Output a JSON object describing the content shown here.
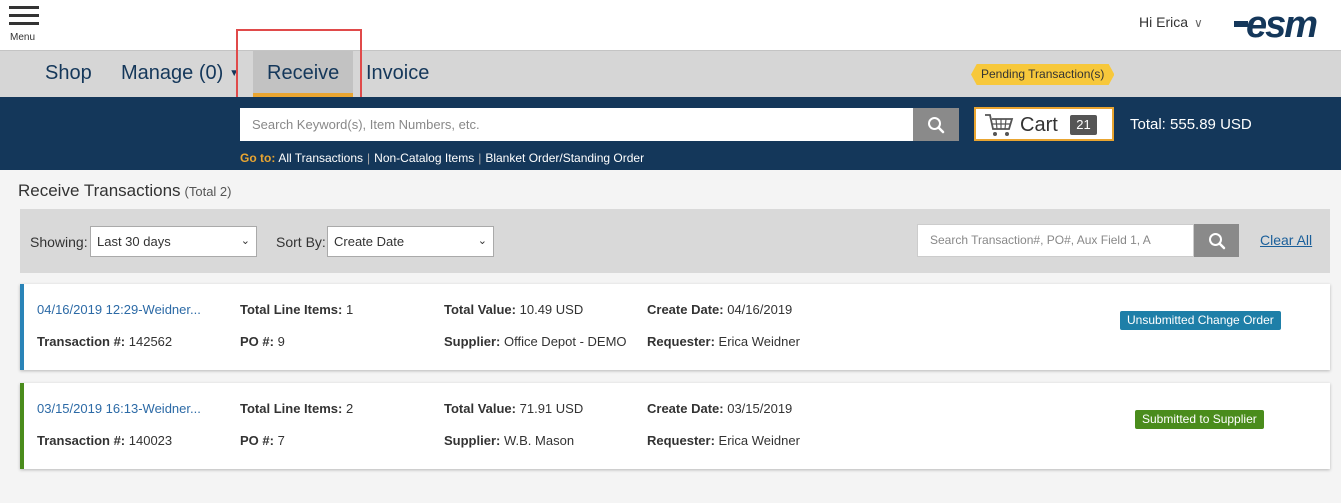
{
  "header": {
    "menu_label": "Menu",
    "greeting": "Hi Erica",
    "logo": "esm"
  },
  "nav": {
    "items": [
      {
        "label": "Shop"
      },
      {
        "label": "Manage (0)"
      },
      {
        "label": "Receive"
      },
      {
        "label": "Invoice"
      }
    ],
    "pending_badge": "Pending Transaction(s)"
  },
  "search": {
    "placeholder": "Search Keyword(s), Item Numbers, etc."
  },
  "cart": {
    "label": "Cart",
    "count": "21",
    "total": "Total: 555.89 USD"
  },
  "goto": {
    "label": "Go to:",
    "links": [
      "All Transactions",
      "Non-Catalog Items",
      "Blanket Order/Standing Order"
    ]
  },
  "page": {
    "title": "Receive Transactions",
    "subtitle": "(Total 2)"
  },
  "filters": {
    "showing_label": "Showing:",
    "showing_value": "Last 30 days",
    "sort_label": "Sort By:",
    "sort_value": "Create Date",
    "search_placeholder": "Search Transaction#, PO#, Aux Field 1, A",
    "clear_all": "Clear All"
  },
  "transactions": [
    {
      "title": "04/16/2019 12:29-Weidner...",
      "transaction_label": "Transaction #:",
      "transaction_no": "142562",
      "line_items_label": "Total Line Items:",
      "line_items": "1",
      "po_label": "PO #:",
      "po": "9",
      "value_label": "Total Value:",
      "value": "10.49 USD",
      "supplier_label": "Supplier:",
      "supplier": "Office Depot - DEMO",
      "create_label": "Create Date:",
      "create_date": "04/16/2019",
      "requester_label": "Requester:",
      "requester": "Erica Weidner",
      "status": "Unsubmitted Change Order",
      "stripe_color": "#2a84b8",
      "status_color": "#1e7fa8"
    },
    {
      "title": "03/15/2019 16:13-Weidner...",
      "transaction_label": "Transaction #:",
      "transaction_no": "140023",
      "line_items_label": "Total Line Items:",
      "line_items": "2",
      "po_label": "PO #:",
      "po": "7",
      "value_label": "Total Value:",
      "value": "71.91 USD",
      "supplier_label": "Supplier:",
      "supplier": "W.B. Mason",
      "create_label": "Create Date:",
      "create_date": "03/15/2019",
      "requester_label": "Requester:",
      "requester": "Erica Weidner",
      "status": "Submitted to Supplier",
      "stripe_color": "#4a8c1c",
      "status_color": "#4a8c1c"
    }
  ],
  "colors": {
    "navy": "#14375a",
    "accent": "#e9a531",
    "highlight": "#e04a4a"
  }
}
